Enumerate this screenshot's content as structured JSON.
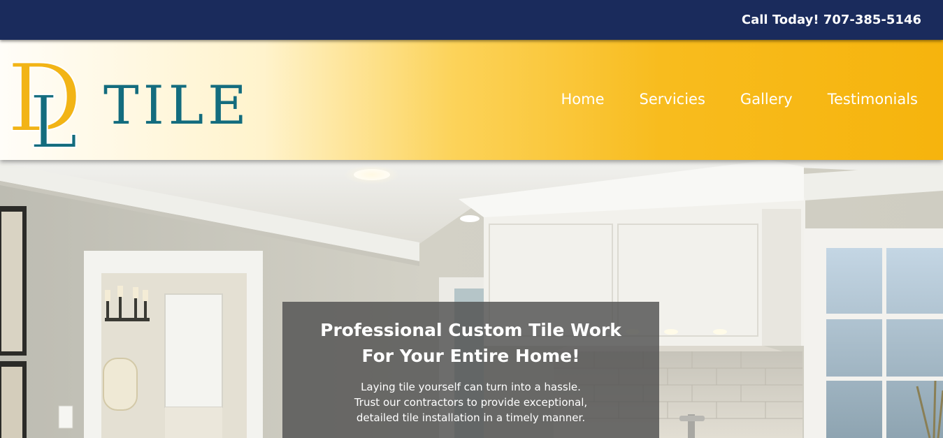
{
  "topbar": {
    "call_text": "Call Today! 707-385-5146"
  },
  "logo": {
    "letter_d": "D",
    "letter_l": "L",
    "word": "TILE"
  },
  "nav": {
    "items": [
      "Home",
      "Servicies",
      "Gallery",
      "Testimonials"
    ]
  },
  "hero": {
    "title_line1": "Professional Custom Tile Work",
    "title_line2": "For Your Entire Home!",
    "text_line1": "Laying tile yourself can turn into a hassle.",
    "text_line2": "Trust our contractors to provide exceptional,",
    "text_line3": "detailed tile installation in a timely manner."
  },
  "colors": {
    "topbar_bg": "#1a2b5c",
    "logo_gold": "#f2b416",
    "logo_teal": "#136c7e",
    "header_gold": "#f6b40d",
    "nav_text": "#ffffff"
  }
}
